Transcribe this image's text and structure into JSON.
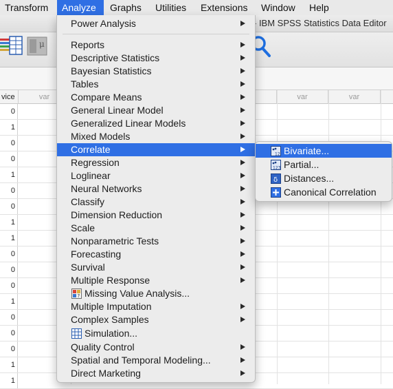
{
  "menubar": {
    "items": [
      "Transform",
      "Analyze",
      "Graphs",
      "Utilities",
      "Extensions",
      "Window",
      "Help"
    ],
    "active": "Analyze"
  },
  "window": {
    "title": "- IBM SPSS Statistics Data Editor"
  },
  "grid": {
    "columns": [
      "vice",
      "var",
      "var",
      "var"
    ],
    "values": [
      "0",
      "1",
      "0",
      "0",
      "1",
      "0",
      "0",
      "1",
      "1",
      "0",
      "0",
      "0",
      "1",
      "0",
      "0",
      "0",
      "1",
      "1"
    ]
  },
  "analyze_menu": {
    "items": [
      {
        "label": "Power Analysis",
        "submenu": true
      },
      {
        "label": "Reports",
        "submenu": true
      },
      {
        "label": "Descriptive Statistics",
        "submenu": true
      },
      {
        "label": "Bayesian Statistics",
        "submenu": true
      },
      {
        "label": "Tables",
        "submenu": true
      },
      {
        "label": "Compare Means",
        "submenu": true
      },
      {
        "label": "General Linear Model",
        "submenu": true
      },
      {
        "label": "Generalized Linear Models",
        "submenu": true
      },
      {
        "label": "Mixed Models",
        "submenu": true
      },
      {
        "label": "Correlate",
        "submenu": true,
        "highlighted": true
      },
      {
        "label": "Regression",
        "submenu": true
      },
      {
        "label": "Loglinear",
        "submenu": true
      },
      {
        "label": "Neural Networks",
        "submenu": true
      },
      {
        "label": "Classify",
        "submenu": true
      },
      {
        "label": "Dimension Reduction",
        "submenu": true
      },
      {
        "label": "Scale",
        "submenu": true
      },
      {
        "label": "Nonparametric Tests",
        "submenu": true
      },
      {
        "label": "Forecasting",
        "submenu": true
      },
      {
        "label": "Survival",
        "submenu": true
      },
      {
        "label": "Multiple Response",
        "submenu": true
      },
      {
        "label": "Missing Value Analysis...",
        "submenu": false,
        "icon": "missing-value-icon"
      },
      {
        "label": "Multiple Imputation",
        "submenu": true
      },
      {
        "label": "Complex Samples",
        "submenu": true
      },
      {
        "label": "Simulation...",
        "submenu": false,
        "icon": "simulation-icon"
      },
      {
        "label": "Quality Control",
        "submenu": true
      },
      {
        "label": "Spatial and Temporal Modeling...",
        "submenu": true
      },
      {
        "label": "Direct Marketing",
        "submenu": true
      }
    ]
  },
  "correlate_submenu": {
    "items": [
      {
        "label": "Bivariate...",
        "icon": "bivariate-icon",
        "highlighted": true
      },
      {
        "label": "Partial...",
        "icon": "partial-icon"
      },
      {
        "label": "Distances...",
        "icon": "distances-icon"
      },
      {
        "label": "Canonical Correlation",
        "icon": "canonical-correlation-icon"
      }
    ]
  },
  "colors": {
    "accent": "#2f6fe4",
    "menu_bg": "#ececec",
    "search_icon": "#1f6fe0"
  }
}
